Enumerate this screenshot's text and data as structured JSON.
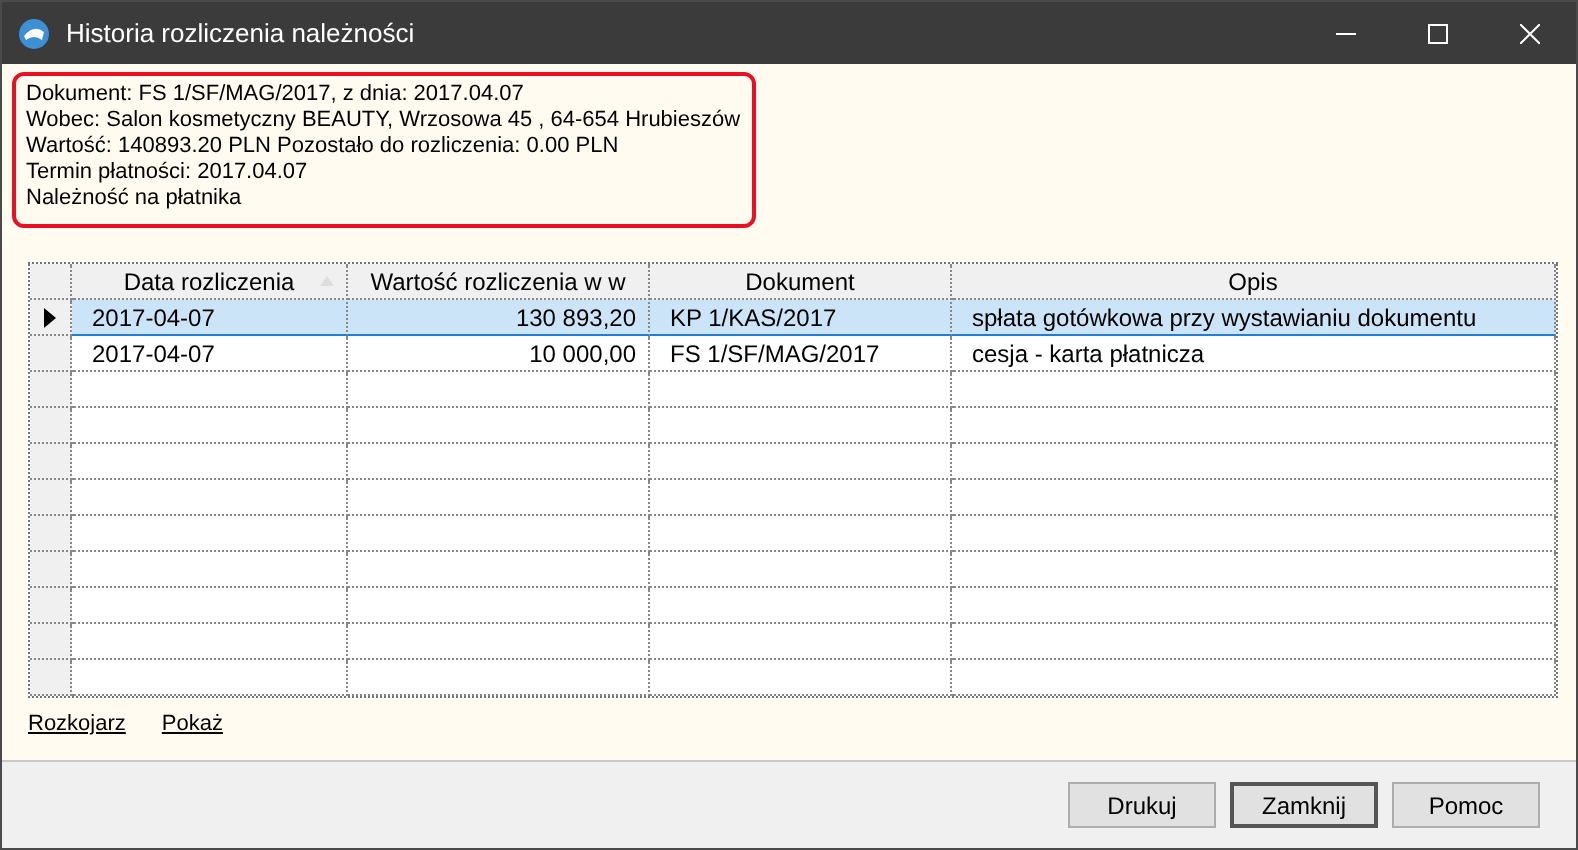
{
  "window": {
    "title": "Historia rozliczenia należności"
  },
  "info": [
    "Dokument: FS 1/SF/MAG/2017, z dnia: 2017.04.07",
    "Wobec: Salon kosmetyczny BEAUTY, Wrzosowa  45 , 64-654 Hrubieszów",
    "Wartość: 140893.20 PLN Pozostało do rozliczenia: 0.00 PLN",
    "Termin płatności: 2017.04.07",
    "Należność na płatnika"
  ],
  "table": {
    "columns": [
      "Data rozliczenia",
      "Wartość rozliczenia w w",
      "Dokument",
      "Opis"
    ],
    "rows": [
      {
        "cells": [
          "2017-04-07",
          "130 893,20",
          "KP 1/KAS/2017",
          "spłata gotówkowa przy wystawianiu dokumentu"
        ],
        "selected": true
      },
      {
        "cells": [
          "2017-04-07",
          "10 000,00",
          "FS 1/SF/MAG/2017",
          "cesja - karta płatnicza"
        ],
        "selected": false
      }
    ]
  },
  "links": [
    "Rozkojarz",
    "Pokaż"
  ],
  "buttons": [
    {
      "label": "Drukuj",
      "default": false
    },
    {
      "label": "Zamknij",
      "default": true
    },
    {
      "label": "Pomoc",
      "default": false
    }
  ]
}
